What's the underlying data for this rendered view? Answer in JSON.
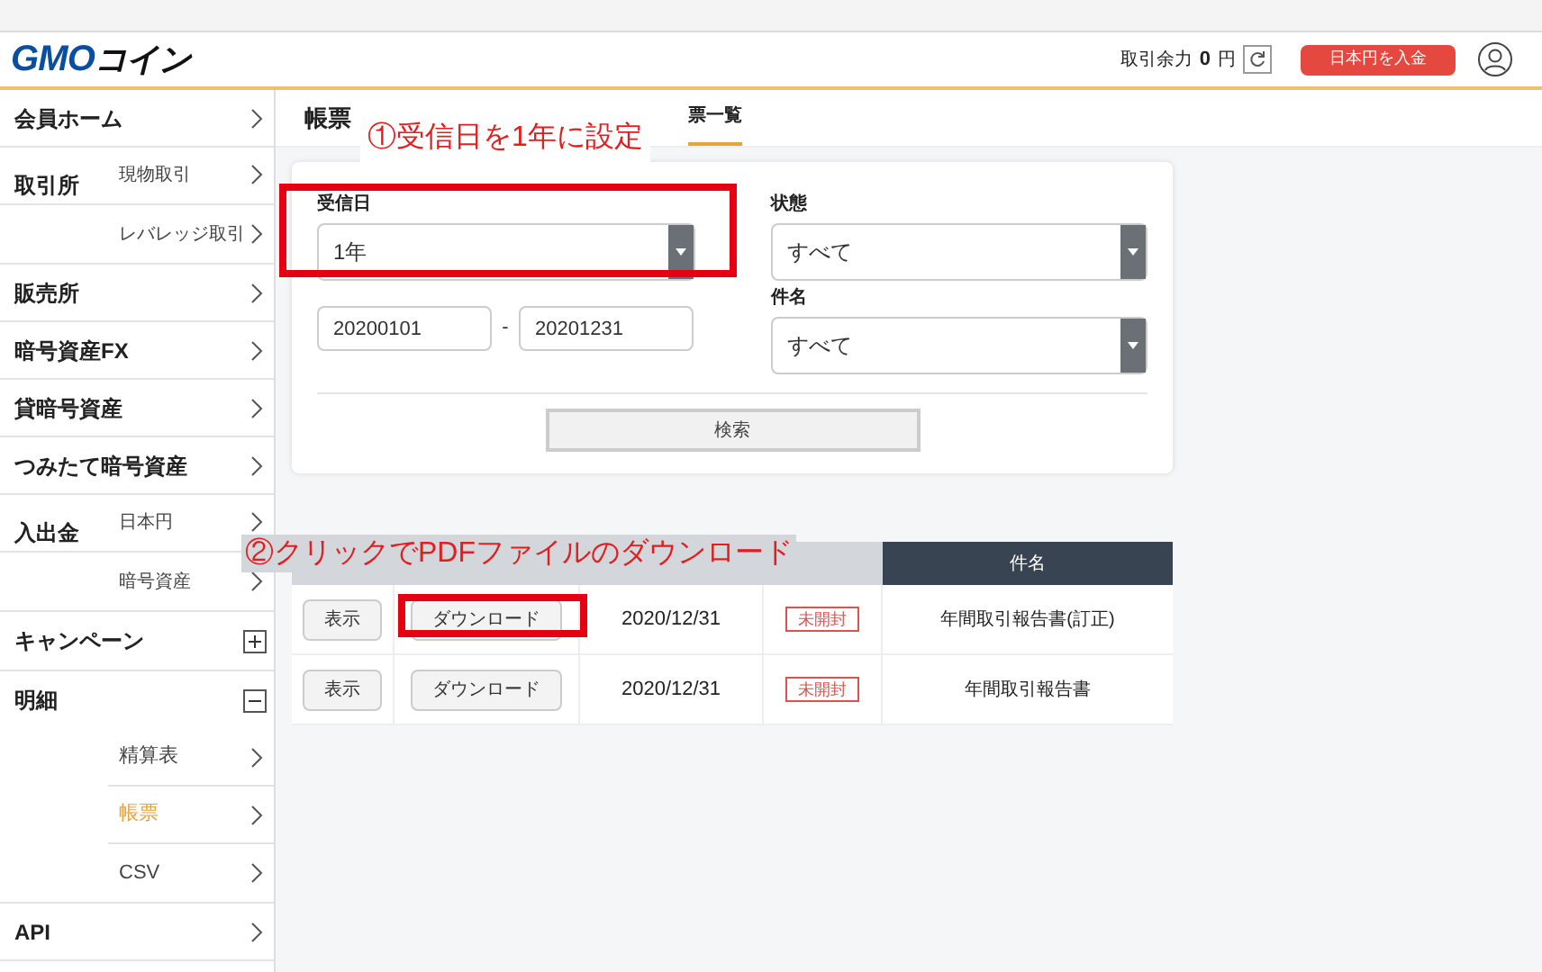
{
  "header": {
    "logo_main": "GMO",
    "logo_sub": "コイン",
    "balance_label": "取引余力",
    "balance_value": "0",
    "balance_unit": "円",
    "deposit_button": "日本円を入金"
  },
  "sidebar": {
    "items": [
      {
        "kind": "link",
        "label": "会員ホーム"
      },
      {
        "kind": "group",
        "label": "取引所",
        "children": [
          {
            "label": "現物取引",
            "selected": false
          },
          {
            "label": "レバレッジ取引",
            "selected": false
          }
        ]
      },
      {
        "kind": "link",
        "label": "販売所"
      },
      {
        "kind": "link",
        "label": "暗号資産FX"
      },
      {
        "kind": "link",
        "label": "貸暗号資産"
      },
      {
        "kind": "link",
        "label": "つみたて暗号資産"
      },
      {
        "kind": "group",
        "label": "入出金",
        "children": [
          {
            "label": "日本円",
            "selected": false
          },
          {
            "label": "暗号資産",
            "selected": false
          }
        ]
      },
      {
        "kind": "toggle",
        "label": "キャンペーン",
        "expanded": false
      },
      {
        "kind": "toggle",
        "label": "明細",
        "expanded": true,
        "children": [
          {
            "label": "精算表",
            "selected": false
          },
          {
            "label": "帳票",
            "selected": true
          },
          {
            "label": "CSV",
            "selected": false
          }
        ]
      },
      {
        "kind": "link",
        "label": "API"
      }
    ]
  },
  "page": {
    "title": "帳票",
    "tabs": [
      {
        "label": "票一覧",
        "selected": true
      }
    ]
  },
  "filters": {
    "date": {
      "label": "受信日",
      "value": "1年",
      "from": "20200101",
      "separator": "-",
      "to": "20201231"
    },
    "status": {
      "label": "状態",
      "value": "すべて"
    },
    "subject": {
      "label": "件名",
      "value": "すべて"
    },
    "search_button": "検索"
  },
  "table": {
    "columns": [
      {},
      {},
      {},
      {},
      {
        "label": "件名"
      }
    ],
    "rows": [
      {
        "view": "表示",
        "download": "ダウンロード",
        "date": "2020/12/31",
        "status": "未開封",
        "subject": "年間取引報告書(訂正)"
      },
      {
        "view": "表示",
        "download": "ダウンロード",
        "date": "2020/12/31",
        "status": "未開封",
        "subject": "年間取引報告書"
      }
    ]
  },
  "annotations": [
    {
      "text": "①受信日を1年に設定"
    },
    {
      "text": "②クリックでPDFファイルのダウンロード"
    }
  ]
}
